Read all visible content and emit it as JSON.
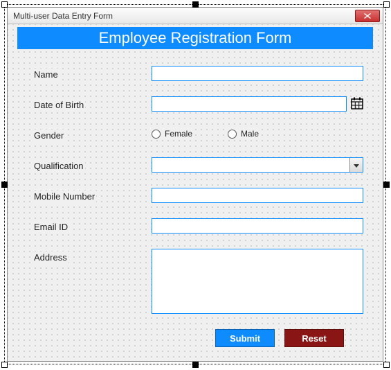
{
  "window": {
    "title": "Multi-user Data Entry Form"
  },
  "header": {
    "title": "Employee Registration Form"
  },
  "labels": {
    "name": "Name",
    "dob": "Date of Birth",
    "gender": "Gender",
    "qualification": "Qualification",
    "mobile": "Mobile Number",
    "email": "Email ID",
    "address": "Address"
  },
  "gender": {
    "female": "Female",
    "male": "Male"
  },
  "fields": {
    "name": "",
    "dob": "",
    "qualification": "",
    "mobile": "",
    "email": "",
    "address": ""
  },
  "buttons": {
    "submit": "Submit",
    "reset": "Reset"
  },
  "colors": {
    "accent": "#0d8bff",
    "reset": "#8a1515"
  }
}
